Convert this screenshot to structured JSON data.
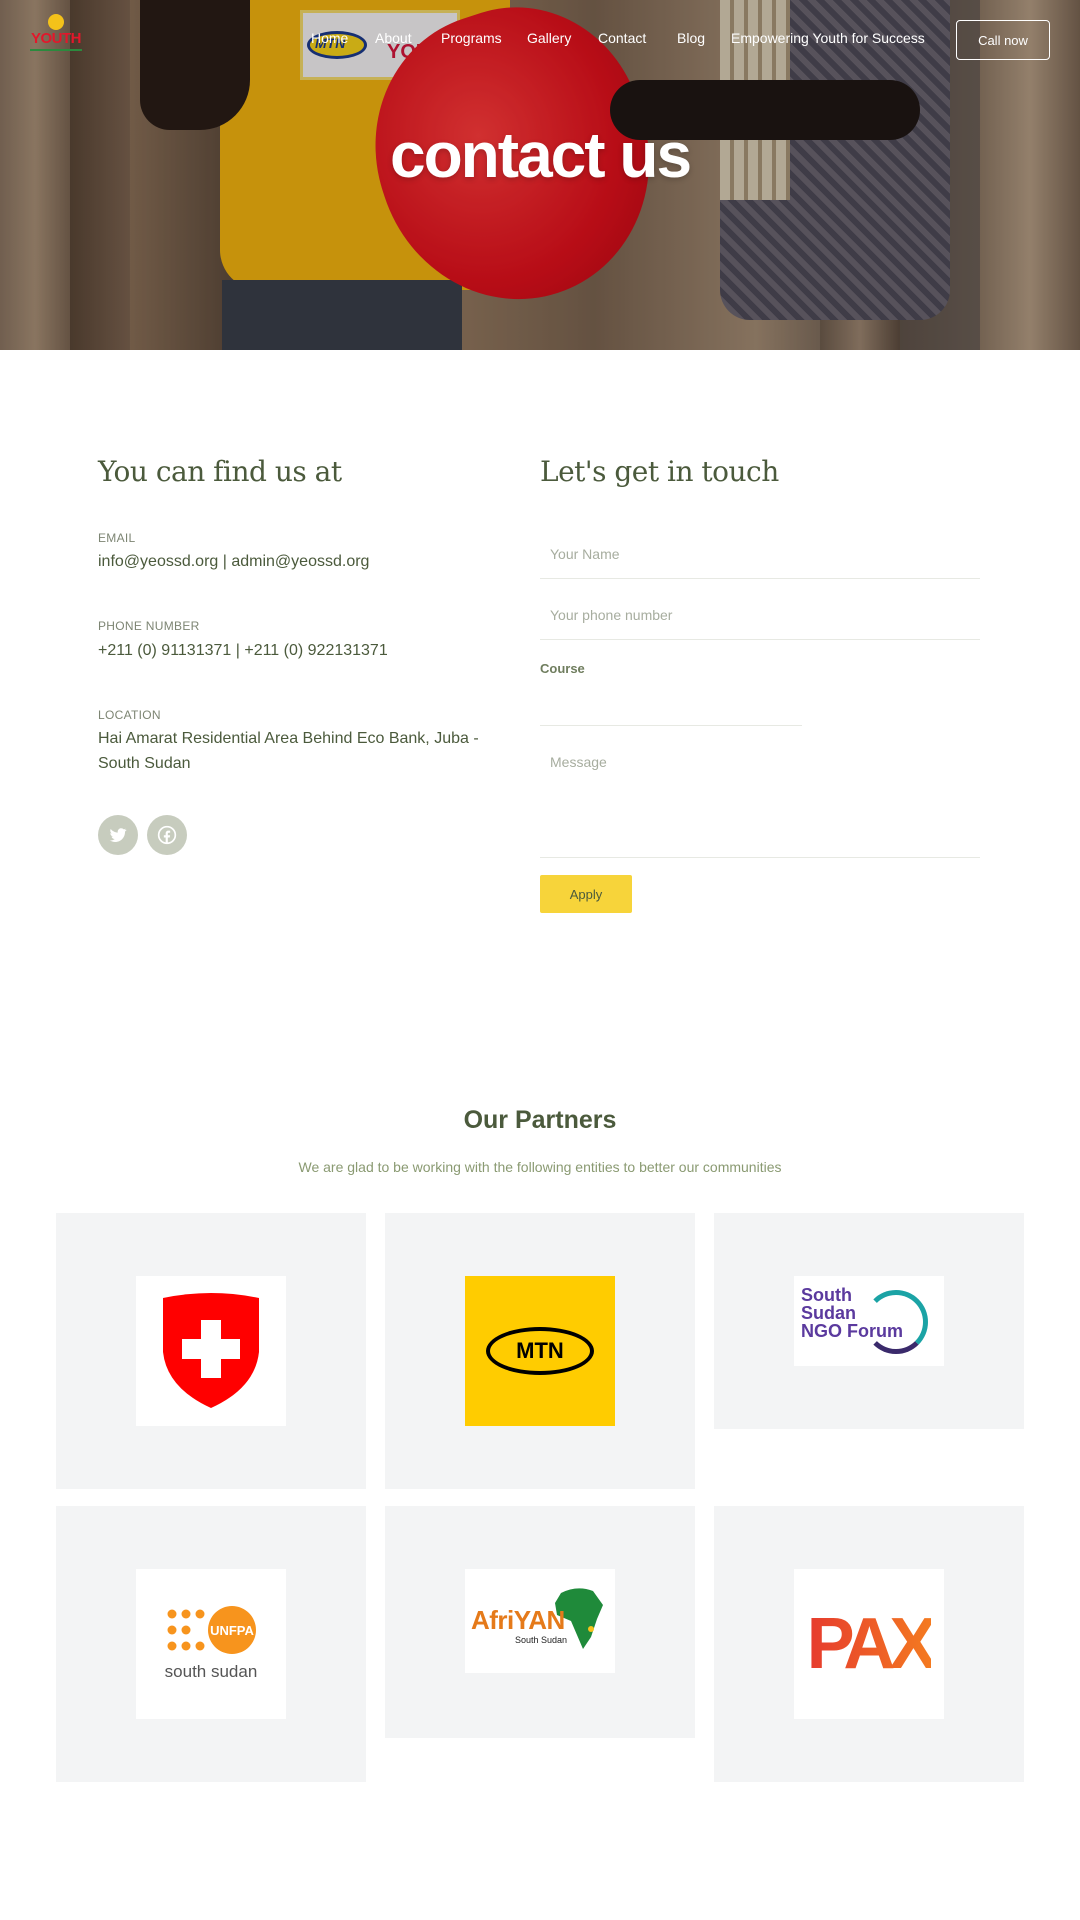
{
  "header": {
    "logo_text": "YOUTH",
    "nav": [
      {
        "label": "Home"
      },
      {
        "label": "About"
      },
      {
        "label": "Programs"
      },
      {
        "label": "Gallery"
      },
      {
        "label": "Contact"
      },
      {
        "label": "Blog"
      },
      {
        "label": "Empowering Youth for Success"
      }
    ],
    "cta_label": "Call now"
  },
  "hero": {
    "title": "contact us",
    "shirt_text": "YOUTH",
    "shirt_brand": "MTN"
  },
  "find_us": {
    "heading": "You can find us at",
    "email_label": "EMAIL",
    "email_value": "info@yeossd.org | admin@yeossd.org",
    "phone_label": "PHONE NUMBER",
    "phone_value": "+211 (0) 91131371 | +211 (0) 922131371",
    "location_label": "LOCATION",
    "location_value": "Hai Amarat Residential Area Behind Eco Bank, Juba - South Sudan",
    "social": [
      {
        "icon": "twitter-icon"
      },
      {
        "icon": "facebook-icon"
      }
    ]
  },
  "contact_form": {
    "heading": "Let's get in touch",
    "name_placeholder": "Your Name",
    "phone_placeholder": "Your phone number",
    "course_label": "Course",
    "course_value": "",
    "message_placeholder": "Message",
    "apply_label": "Apply"
  },
  "partners": {
    "title": "Our Partners",
    "subtitle": "We are glad to be working with the following entities to better our communities",
    "items": [
      {
        "name": "swiss-flag-logo"
      },
      {
        "name": "mtn-logo",
        "text": "MTN"
      },
      {
        "name": "ngo-forum-logo",
        "lines": [
          "South",
          "Sudan",
          "NGO Forum"
        ]
      },
      {
        "name": "unfpa-logo",
        "text": "UNFPA",
        "caption": "south sudan"
      },
      {
        "name": "afriyan-logo",
        "text": "AfriYAN",
        "caption": "South Sudan"
      },
      {
        "name": "pax-logo",
        "text": "PAX"
      }
    ]
  },
  "colors": {
    "text": "#4b5a3c",
    "accent_yellow": "#f7d43a",
    "card_bg": "#f3f4f5"
  }
}
